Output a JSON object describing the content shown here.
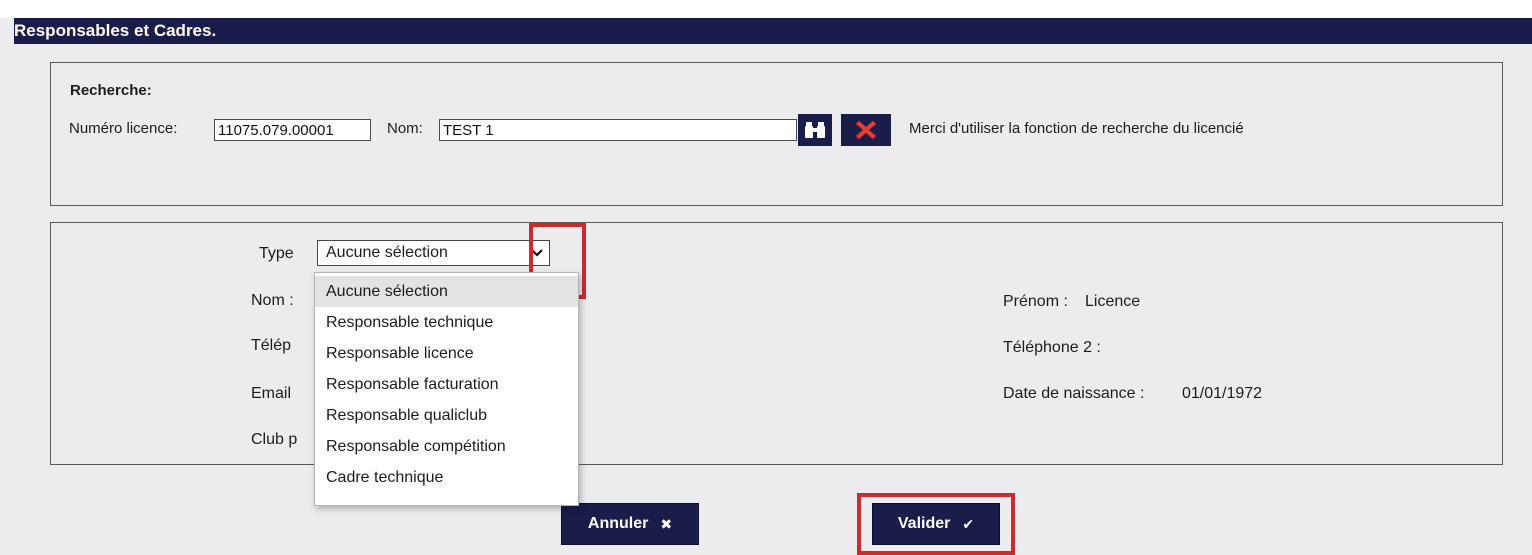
{
  "header": {
    "title": "Responsables et Cadres."
  },
  "search": {
    "heading": "Recherche:",
    "licence_label": "Numéro licence:",
    "licence_value": "11075.079.00001",
    "nom_label": "Nom:",
    "nom_value": "TEST 1",
    "search_icon": "binoculars-icon",
    "clear_icon": "red-cross-icon",
    "hint": "Merci d'utiliser la fonction de recherche du licencié"
  },
  "details": {
    "type_label": "Type",
    "type_selected": "Aucune sélection",
    "nom_label": "Nom :",
    "telephone_label": "Télép",
    "email_label": "Email",
    "club_label": "Club p",
    "prenom_label": "Prénom :",
    "prenom_value": "Licence",
    "telephone2_label": "Téléphone 2 :",
    "dob_label": "Date de naissance :",
    "dob_value": "01/01/1972"
  },
  "type_options": [
    "Aucune sélection",
    "Responsable technique",
    "Responsable licence",
    "Responsable facturation",
    "Responsable qualiclub",
    "Responsable compétition",
    "Cadre technique"
  ],
  "buttons": {
    "cancel_label": "Annuler",
    "cancel_icon": "close-icon",
    "validate_label": "Valider",
    "validate_icon": "checkmark-icon"
  },
  "colors": {
    "navy": "#1a1c4a",
    "highlight_red": "#d0282f",
    "clear_red": "#e2403a"
  }
}
